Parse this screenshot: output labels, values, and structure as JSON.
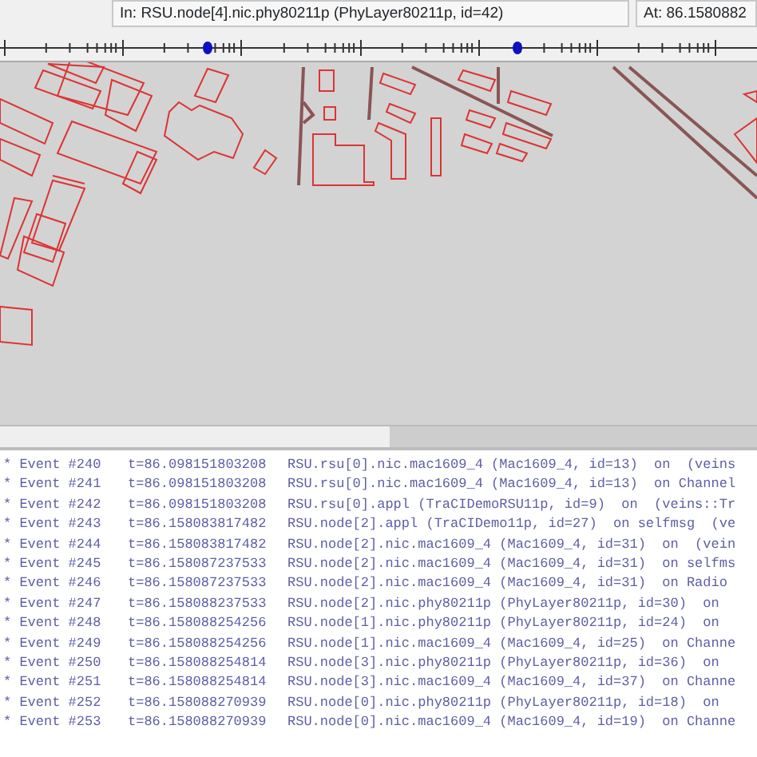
{
  "status_bar": {
    "module": "In: RSU.node[4].nic.phy80211p (PhyLayer80211p, id=42)",
    "time": "At: 86.1580882"
  },
  "log": [
    {
      "event": "* Event #240",
      "time": "t=86.098151803208",
      "message": "RSU.rsu[0].nic.mac1609_4 (Mac1609_4, id=13)  on  (veins"
    },
    {
      "event": "* Event #241",
      "time": "t=86.098151803208",
      "message": "RSU.rsu[0].nic.mac1609_4 (Mac1609_4, id=13)  on Channel"
    },
    {
      "event": "* Event #242",
      "time": "t=86.098151803208",
      "message": "RSU.rsu[0].appl (TraCIDemoRSU11p, id=9)  on  (veins::Tr"
    },
    {
      "event": "* Event #243",
      "time": "t=86.158083817482",
      "message": "RSU.node[2].appl (TraCIDemo11p, id=27)  on selfmsg  (ve"
    },
    {
      "event": "* Event #244",
      "time": "t=86.158083817482",
      "message": "RSU.node[2].nic.mac1609_4 (Mac1609_4, id=31)  on  (vein"
    },
    {
      "event": "* Event #245",
      "time": "t=86.158087237533",
      "message": "RSU.node[2].nic.mac1609_4 (Mac1609_4, id=31)  on selfms"
    },
    {
      "event": "* Event #246",
      "time": "t=86.158087237533",
      "message": "RSU.node[2].nic.mac1609_4 (Mac1609_4, id=31)  on Radio"
    },
    {
      "event": "* Event #247",
      "time": "t=86.158088237533",
      "message": "RSU.node[2].nic.phy80211p (PhyLayer80211p, id=30)  on"
    },
    {
      "event": "* Event #248",
      "time": "t=86.158088254256",
      "message": "RSU.node[1].nic.phy80211p (PhyLayer80211p, id=24)  on"
    },
    {
      "event": "* Event #249",
      "time": "t=86.158088254256",
      "message": "RSU.node[1].nic.mac1609_4 (Mac1609_4, id=25)  on Channe"
    },
    {
      "event": "* Event #250",
      "time": "t=86.158088254814",
      "message": "RSU.node[3].nic.phy80211p (PhyLayer80211p, id=36)  on"
    },
    {
      "event": "* Event #251",
      "time": "t=86.158088254814",
      "message": "RSU.node[3].nic.mac1609_4 (Mac1609_4, id=37)  on Channe"
    },
    {
      "event": "* Event #252",
      "time": "t=86.158088270939",
      "message": "RSU.node[0].nic.phy80211p (PhyLayer80211p, id=18)  on"
    },
    {
      "event": "* Event #253",
      "time": "t=86.158088270939",
      "message": "RSU.node[0].nic.mac1609_4 (Mac1609_4, id=19)  on Channe"
    }
  ]
}
